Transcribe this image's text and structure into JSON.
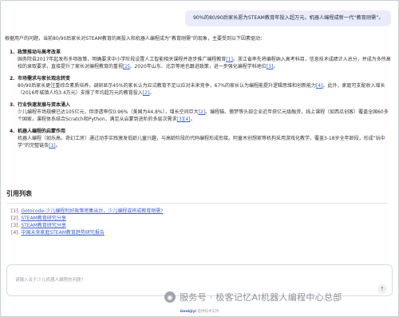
{
  "query": "90%的80/90后家长愿为STEAM教育年投入超万元，机器人编程成新一代“教育刚需”。",
  "intro": "根据用户的问题，当前80/90后家长对STEAM教育的高投入和机器人编程成为“教育刚需”的现象，主要受到以下因素驱动：",
  "sections": [
    {
      "num": "1.",
      "title": "政策推动与高考改革",
      "body": [
        {
          "t": "国务院自2017年起发布多项政策，明确要求中小学阶段设置人工智能相关课程并逐步推广编程教育"
        },
        {
          "t": "[1]",
          "link": true
        },
        {
          "t": "。浙江省率先将编程纳入高考科目，信息技术成绩计入总分，并成为多所高校的录取要求，直接提升了家长对编程教育的重视"
        },
        {
          "t": "[2]",
          "link": true
        },
        {
          "t": "。2020年山东、北京等地也跟进政策，进一步强化编程学科地位"
        },
        {
          "t": "[3]",
          "link": true
        },
        {
          "t": "。"
        }
      ]
    },
    {
      "num": "2.",
      "title": "市场需求与家长观念转变",
      "body": [
        {
          "t": "80/90后家长更注重综合素质培养，调研显示45%的家长认为应试教育不足以应对未来竞争，67%的家长认为编程能提升逻辑思维和创新能力"
        },
        {
          "t": "[4]",
          "link": true
        },
        {
          "t": "。此外，家庭可支配收入增长（2016年城镇人均3.4万元）支撑了年均超万元的教育投入"
        },
        {
          "t": "[2]",
          "link": true
        },
        {
          "t": "。"
        }
      ]
    },
    {
      "num": "3.",
      "title": "行业快速发展与资本涌入",
      "body": [
        {
          "t": "少儿编程市场规模已达105亿元，但渗透率仅0.96%（美国为44.8%），增长空间巨大"
        },
        {
          "t": "[2]",
          "link": true
        },
        {
          "t": "。编程猫、傲梦等头部企业近年获亿元级融资，线上课程（如西瓜创客）覆盖全国60多个国家，课程体系结合Scratch和Python，满足从启蒙到进阶的多层次需求"
        },
        {
          "t": "[3][4]",
          "link": true
        },
        {
          "t": "。"
        }
      ]
    },
    {
      "num": "4.",
      "title": "机器人编程的启蒙作用",
      "body": [
        {
          "t": "机器人编程（如乐高、奇幻工房）通过动手实践激发低龄儿童兴趣，与高龄阶段的代码编程形成衔接。阿童木创想家等机构采用游戏化教学，覆盖3-18岁全年龄段，形成“玩中学”的完整链条"
        },
        {
          "t": "[1]",
          "link": true
        },
        {
          "t": "。"
        }
      ]
    }
  ],
  "citations_title": "引用列表",
  "citations": [
    {
      "idx": "[1].",
      "text": "Gotocode-少儿编程利好政策密集出台，少儿编程或将成教育刚需?"
    },
    {
      "idx": "[2].",
      "text": "STEAM教育研究分享"
    },
    {
      "idx": "[3].",
      "text": "STEAM教育研究分享"
    },
    {
      "idx": "[4].",
      "text": "中国未来家庭STEAM教育趋势研究报告"
    }
  ],
  "input": {
    "placeholder": "请输入关于少儿机器人编程的问题?"
  },
  "send_icon": "arrow-up-icon",
  "footer": {
    "brand": "Geekjiyi",
    "text": "提供技术支持"
  },
  "watermark": {
    "text": "服务号 · 极客记忆AI机器人编程中心总部"
  },
  "colors": {
    "bubble_bg": "#e9edfb",
    "link": "#3a60d6"
  }
}
